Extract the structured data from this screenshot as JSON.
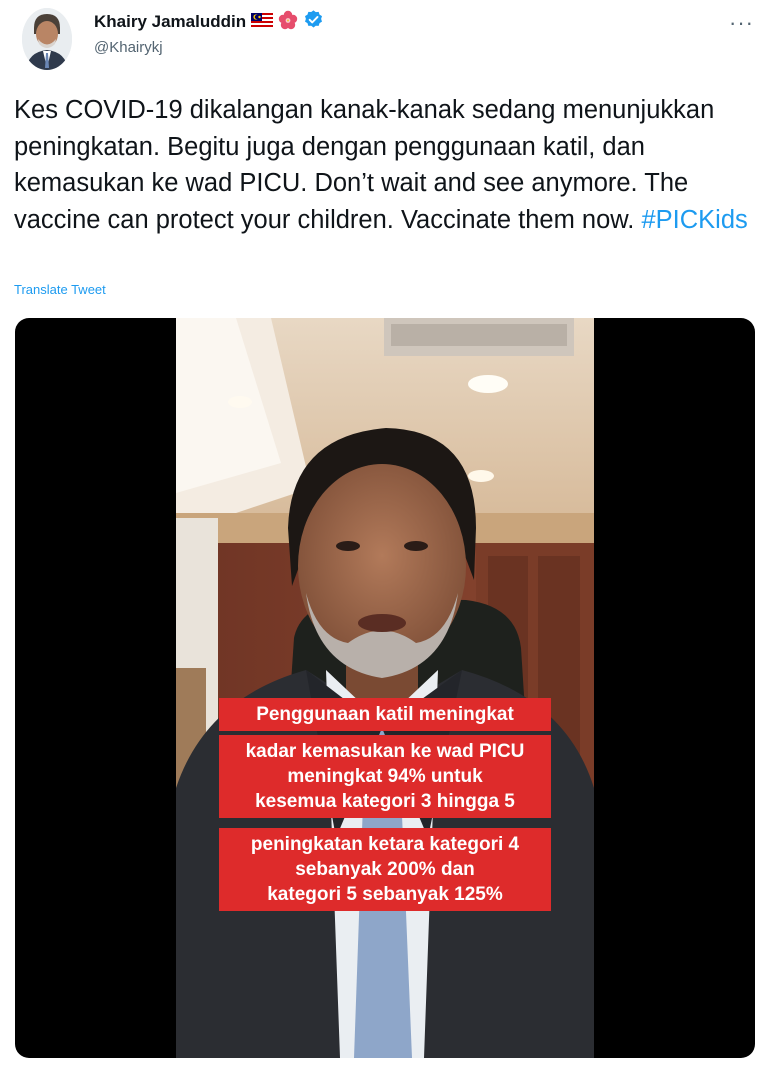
{
  "tweet": {
    "author_name": "Khairy Jamaluddin",
    "handle": "@Khairykj",
    "text_main": "Kes COVID-19 dikalangan kanak-kanak sedang menunjukkan peningkatan. Begitu juga dengan penggunaan katil, dan kemasukan ke wad PICU. Don’t wait and see anymore. The vaccine can protect your children. Vaccinate them now. ",
    "hashtag": "#PICKids",
    "translate_label": "Translate Tweet",
    "more_label": "···"
  },
  "media": {
    "captions": [
      {
        "lines": [
          "Penggunaan katil meningkat"
        ]
      },
      {
        "lines": [
          "kadar kemasukan ke wad PICU",
          "meningkat 94% untuk",
          "kesemua kategori 3 hingga 5"
        ]
      },
      {
        "lines": [
          "peningkatan ketara kategori 4",
          "sebanyak 200% dan",
          "kategori 5 sebanyak 125%"
        ]
      }
    ]
  },
  "colors": {
    "link": "#1d9bf0",
    "verified": "#1d9bf0",
    "caption_bg": "#de2b2b",
    "handle": "#536471"
  }
}
